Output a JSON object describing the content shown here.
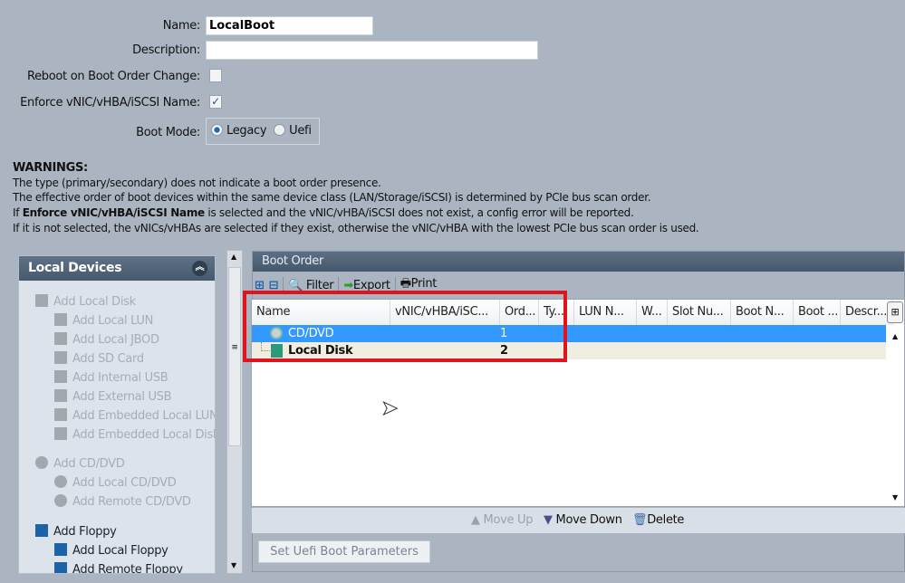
{
  "form": {
    "name_label": "Name:",
    "name_value": "LocalBoot",
    "description_label": "Description:",
    "description_value": "",
    "reboot_label": "Reboot on Boot Order Change:",
    "reboot_checked": false,
    "enforce_label": "Enforce vNIC/vHBA/iSCSI Name:",
    "enforce_checked": true,
    "boot_mode_label": "Boot Mode:",
    "boot_mode_options": [
      "Legacy",
      "Uefi"
    ],
    "boot_mode_selected": "Legacy"
  },
  "warnings": {
    "title": "WARNINGS:",
    "line1": "The type (primary/secondary) does not indicate a boot order presence.",
    "line2": "The effective order of boot devices within the same device class (LAN/Storage/iSCSI) is determined by PCIe bus scan order.",
    "line3_pre": "If ",
    "line3_bold": "Enforce vNIC/vHBA/iSCSI Name",
    "line3_post": " is selected and the vNIC/vHBA/iSCSI does not exist, a config error will be reported.",
    "line4": "If it is not selected, the vNICs/vHBAs are selected if they exist, otherwise the vNIC/vHBA with the lowest PCIe bus scan order is used."
  },
  "local_devices": {
    "title": "Local Devices",
    "items": [
      {
        "label": "Add Local Disk",
        "enabled": false,
        "icon": "disk-icon"
      },
      {
        "label": "Add Local LUN",
        "enabled": false,
        "icon": "disk-icon"
      },
      {
        "label": "Add Local JBOD",
        "enabled": false,
        "icon": "disk-icon"
      },
      {
        "label": "Add SD Card",
        "enabled": false,
        "icon": "disk-icon"
      },
      {
        "label": "Add Internal USB",
        "enabled": false,
        "icon": "disk-icon"
      },
      {
        "label": "Add External USB",
        "enabled": false,
        "icon": "disk-icon"
      },
      {
        "label": "Add Embedded Local LUN",
        "enabled": false,
        "icon": "disk-icon"
      },
      {
        "label": "Add Embedded Local Disk",
        "enabled": false,
        "icon": "disk-icon"
      },
      {
        "label": "Add CD/DVD",
        "enabled": false,
        "icon": "cd-icon"
      },
      {
        "label": "Add Local CD/DVD",
        "enabled": false,
        "icon": "cd-icon"
      },
      {
        "label": "Add Remote CD/DVD",
        "enabled": false,
        "icon": "cd-icon"
      },
      {
        "label": "Add Floppy",
        "enabled": true,
        "icon": "floppy-icon"
      },
      {
        "label": "Add Local Floppy",
        "enabled": true,
        "icon": "floppy-icon"
      },
      {
        "label": "Add Remote Floppy",
        "enabled": true,
        "icon": "floppy-icon"
      }
    ]
  },
  "boot_order": {
    "title": "Boot Order",
    "toolbar": {
      "filter": "Filter",
      "export": "Export",
      "print": "Print"
    },
    "columns": [
      "Name",
      "vNIC/vHBA/iSC...",
      "Ord...",
      "Ty...",
      "LUN N...",
      "W...",
      "Slot Nu...",
      "Boot N...",
      "Boot ...",
      "Descr..."
    ],
    "rows": [
      {
        "name": "CD/DVD",
        "order": "1",
        "selected": true
      },
      {
        "name": "Local Disk",
        "order": "2",
        "selected": false
      }
    ],
    "move_up": "Move Up",
    "move_down": "Move Down",
    "delete": "Delete",
    "set_uefi": "Set Uefi Boot Parameters"
  },
  "colors": {
    "selection": "#3399ff",
    "highlight_box": "#e0141b",
    "panel_header": "#4f6276"
  }
}
